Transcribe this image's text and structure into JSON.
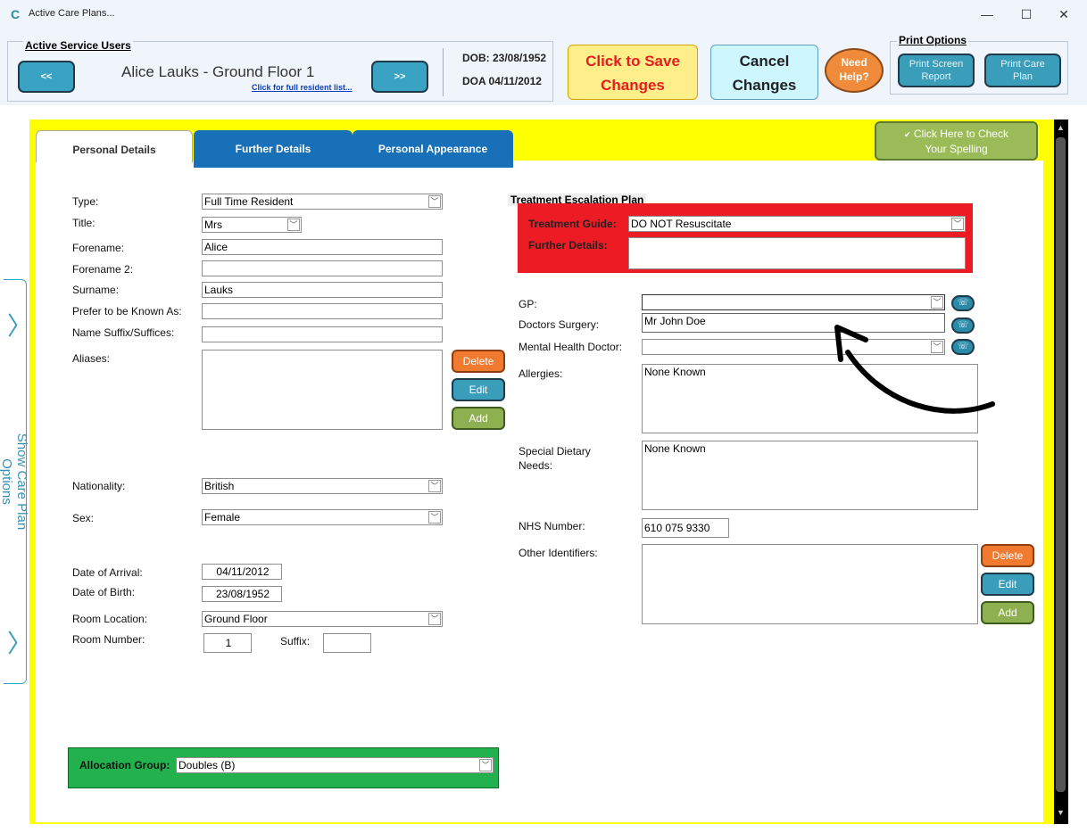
{
  "window": {
    "title": "Active Care Plans...",
    "app_icon": "care-logo-icon"
  },
  "window_controls": {
    "minimize": "—",
    "maximize": "☐",
    "close": "✕"
  },
  "service_users": {
    "legend": "Active Service Users",
    "prev_label": "<<",
    "next_label": ">>",
    "resident_name": "Alice Lauks - Ground Floor 1",
    "resident_list_link": "Click for full resident list...",
    "dob": "DOB: 23/08/1952",
    "doa": "DOA 04/11/2012"
  },
  "actions": {
    "save_line1": "Click to Save",
    "save_line2": "Changes",
    "cancel_line1": "Cancel",
    "cancel_line2": "Changes",
    "help_line1": "Need",
    "help_line2": "Help?"
  },
  "print_options": {
    "legend": "Print Options",
    "screen_report_line1": "Print Screen",
    "screen_report_line2": "Report",
    "care_plan_line1": "Print Care",
    "care_plan_line2": "Plan"
  },
  "tabs": [
    {
      "label": "Personal Details",
      "active": true
    },
    {
      "label": "Further Details",
      "active": false
    },
    {
      "label": "Personal Appearance",
      "active": false
    }
  ],
  "spellcheck": {
    "line1": "Click Here to Check",
    "line2": "Your Spelling"
  },
  "personal": {
    "type_label": "Type:",
    "type_value": "Full Time Resident",
    "title_label": "Title:",
    "title_value": "Mrs",
    "forename_label": "Forename:",
    "forename_value": "Alice",
    "forename2_label": "Forename 2:",
    "forename2_value": "",
    "surname_label": "Surname:",
    "surname_value": "Lauks",
    "known_as_label": "Prefer to be Known As:",
    "known_as_value": "",
    "suffix_label": "Name Suffix/Suffices:",
    "suffix_value": "",
    "aliases_label": "Aliases:",
    "nationality_label": "Nationality:",
    "nationality_value": "British",
    "sex_label": "Sex:",
    "sex_value": "Female",
    "arrival_label": "Date of Arrival:",
    "arrival_value": "04/11/2012",
    "birth_label": "Date of Birth:",
    "birth_value": "23/08/1952",
    "room_location_label": "Room Location:",
    "room_location_value": "Ground Floor",
    "room_number_label": "Room Number:",
    "room_number_value": "1",
    "room_suffix_label": "Suffix:",
    "room_suffix_value": ""
  },
  "alias_buttons": {
    "delete": "Delete",
    "edit": "Edit",
    "add": "Add"
  },
  "treatment_plan": {
    "heading": "Treatment Escalation Plan",
    "guide_label": "Treatment Guide:",
    "guide_value": "DO NOT Resuscitate",
    "details_label": "Further Details:",
    "details_value": ""
  },
  "medical": {
    "gp_label": "GP:",
    "gp_value": "",
    "gp_dropdown_option": "Mr John Doe",
    "surgery_label": "Doctors Surgery:",
    "mh_doctor_label": "Mental Health Doctor:",
    "mh_doctor_value": "",
    "allergies_label": "Allergies:",
    "allergies_value": "None Known",
    "dietary_label": "Special Dietary Needs:",
    "dietary_value": "None Known",
    "nhs_label": "NHS Number:",
    "nhs_value": "610 075 9330",
    "other_ids_label": "Other Identifiers:"
  },
  "identifier_buttons": {
    "delete": "Delete",
    "edit": "Edit",
    "add": "Add"
  },
  "allocation": {
    "label": "Allocation Group:",
    "value": "Doubles (B)"
  },
  "side_panel": {
    "label": "Show Care Plan Options"
  },
  "colors": {
    "frame_yellow": "#ffff00",
    "tab_blue": "#1870b8",
    "tep_red": "#ed1c24",
    "alloc_green": "#22b14c",
    "save_text_red": "#e02020"
  }
}
